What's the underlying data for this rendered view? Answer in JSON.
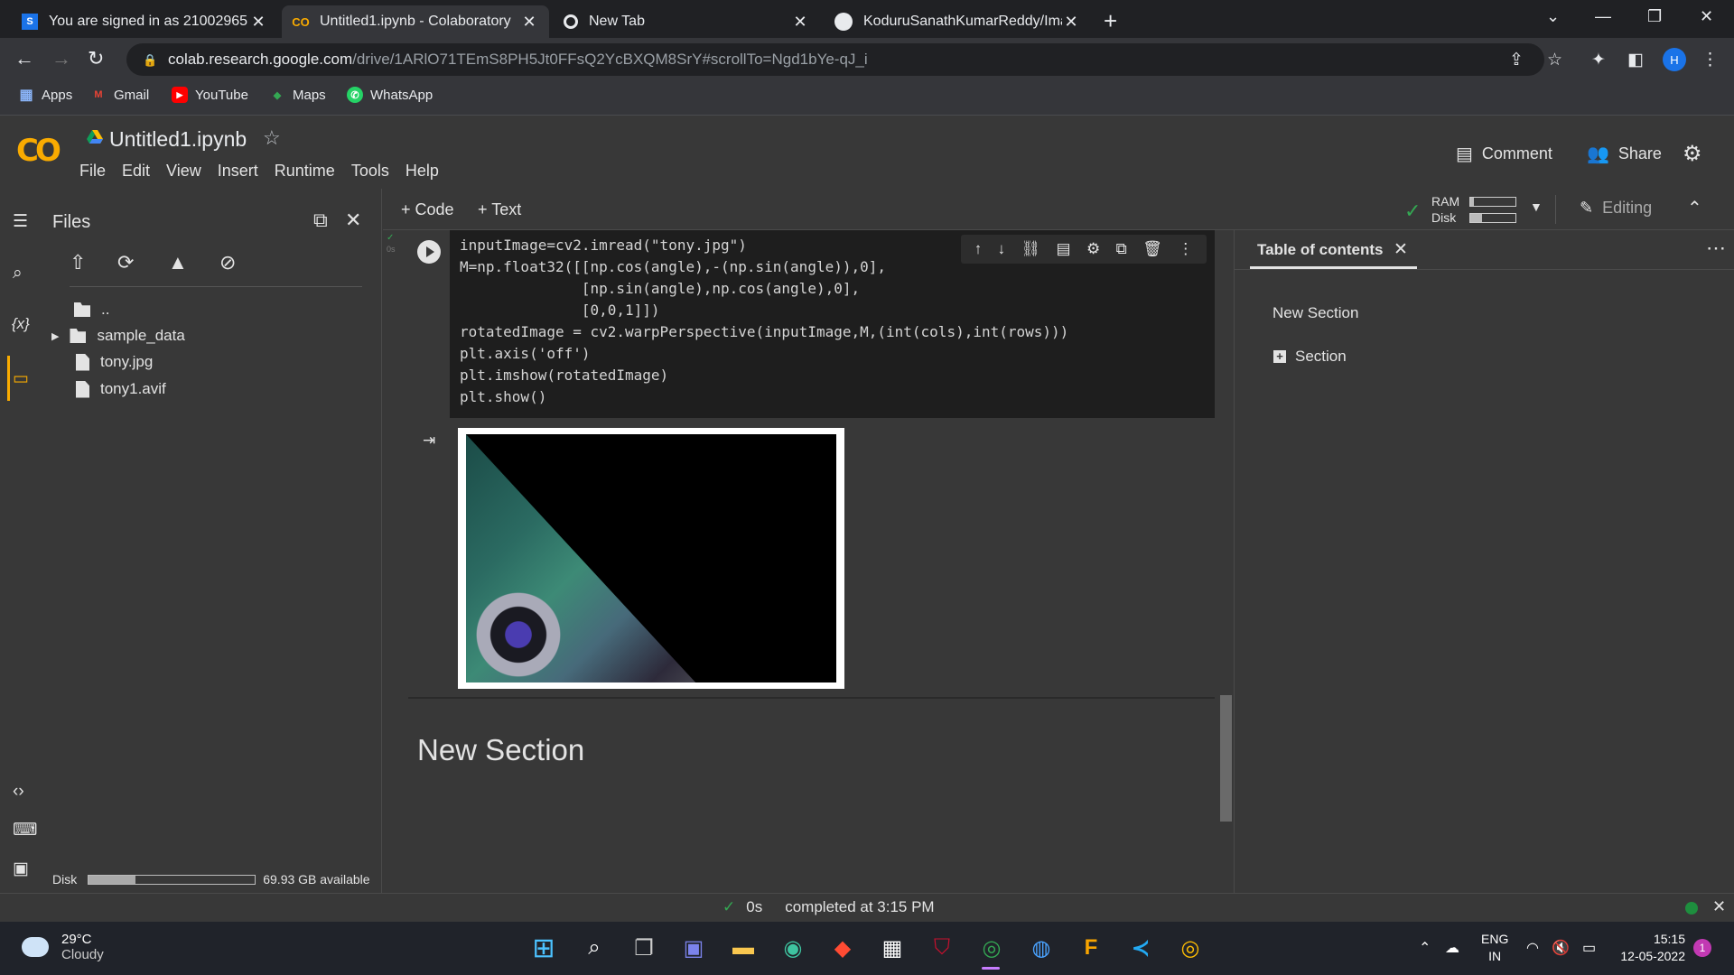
{
  "browser": {
    "tabs": [
      {
        "title": "You are signed in as 21002965",
        "favicon": "s-icon"
      },
      {
        "title": "Untitled1.ipynb - Colaboratory",
        "favicon": "colab-icon"
      },
      {
        "title": "New Tab",
        "favicon": "chrome-icon"
      },
      {
        "title": "KoduruSanathKumarReddy/Imag",
        "favicon": "github-icon"
      }
    ],
    "url_host": "colab.research.google.com",
    "url_path": "/drive/1ARlO71TEmS8PH5Jt0FFsQ2YcBXQM8SrY#scrollTo=Ngd1bYe-qJ_i",
    "profile_initial": "H",
    "bookmarks": [
      "Apps",
      "Gmail",
      "YouTube",
      "Maps",
      "WhatsApp"
    ]
  },
  "colab": {
    "notebook_title": "Untitled1.ipynb",
    "menu": [
      "File",
      "Edit",
      "View",
      "Insert",
      "Runtime",
      "Tools",
      "Help"
    ],
    "comment_label": "Comment",
    "share_label": "Share",
    "add_code_label": "+ Code",
    "add_text_label": "+ Text",
    "ram_label": "RAM",
    "disk_label": "Disk",
    "ram_usage": 0.08,
    "disk_usage": 0.25,
    "editing_label": "Editing"
  },
  "files": {
    "title": "Files",
    "items": [
      {
        "name": "..",
        "type": "parent"
      },
      {
        "name": "sample_data",
        "type": "folder"
      },
      {
        "name": "tony.jpg",
        "type": "file"
      },
      {
        "name": "tony1.avif",
        "type": "file"
      }
    ],
    "disk_label": "Disk",
    "disk_available": "69.93 GB available",
    "disk_usage": 0.28
  },
  "cell": {
    "gutter_status": "0s",
    "code_lines": [
      "inputImage=cv2.imread(\"tony.jpg\")",
      "M=np.float32([[np.cos(angle),-(np.sin(angle)),0],",
      "              [np.sin(angle),np.cos(angle),0],",
      "              [0,0,1]])",
      "rotatedImage = cv2.warpPerspective(inputImage,M,(int(cols),int(rows)))",
      "plt.axis('off')",
      "plt.imshow(rotatedImage)",
      "plt.show()"
    ]
  },
  "section_heading": "New Section",
  "toc": {
    "title": "Table of contents",
    "items": [
      "New Section",
      "Section"
    ]
  },
  "status": {
    "duration": "0s",
    "message": "completed at 3:15 PM"
  },
  "taskbar": {
    "temperature": "29°C",
    "weather": "Cloudy",
    "lang_1": "ENG",
    "lang_2": "IN",
    "time": "15:15",
    "date": "12-05-2022",
    "notifications": "1"
  }
}
